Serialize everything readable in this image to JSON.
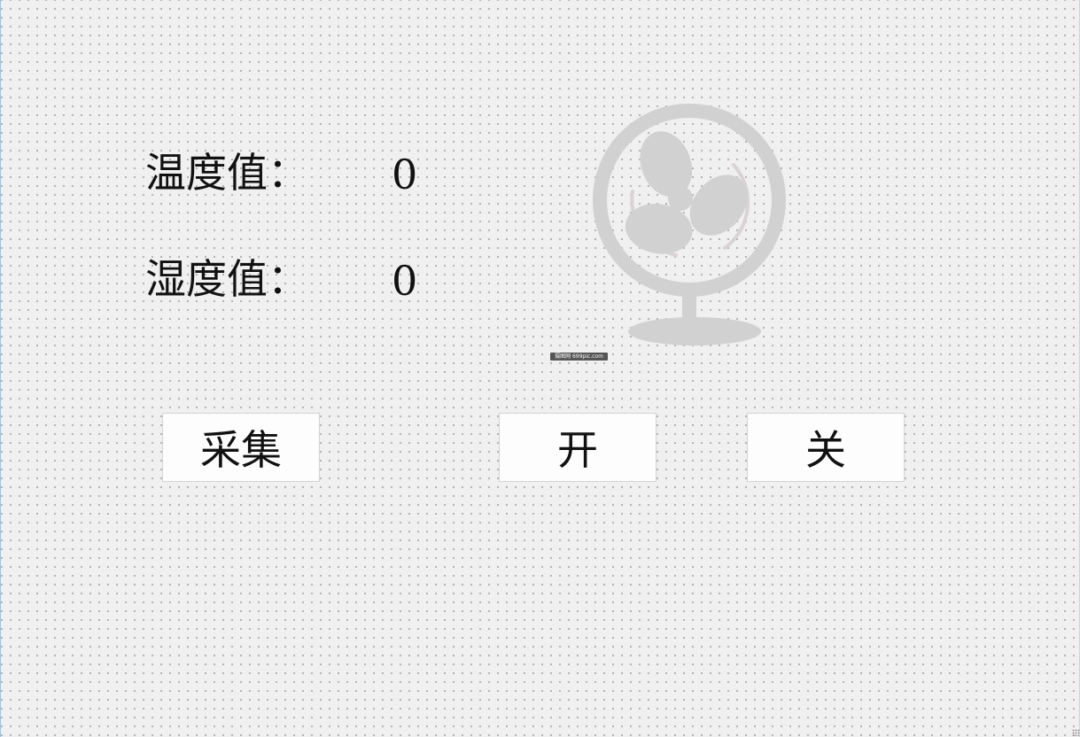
{
  "sensors": {
    "temperature_label": "温度值：",
    "temperature_value": "0",
    "humidity_label": "湿度值：",
    "humidity_value": "0"
  },
  "buttons": {
    "collect_label": "采集",
    "on_label": "开",
    "off_label": "关"
  },
  "image": {
    "icon": "fan-icon",
    "watermark_text": "摄图网 699pic.com"
  },
  "colors": {
    "background": "#f0f0f0",
    "fan_gray": "#d1d1d1",
    "text": "#111111"
  }
}
